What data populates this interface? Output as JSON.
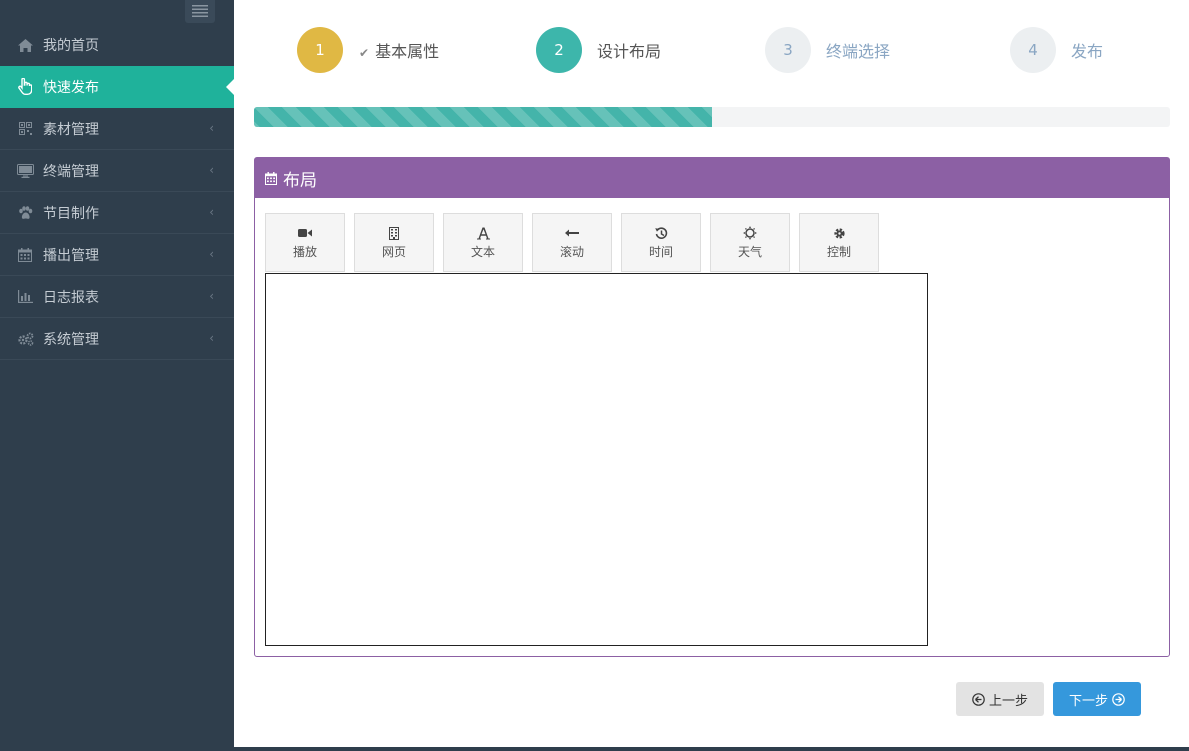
{
  "sidebar": {
    "toggle_icon": "menu-lines-icon",
    "items": [
      {
        "label": "我的首页",
        "icon": "home-icon",
        "active": false
      },
      {
        "label": "快速发布",
        "icon": "hand-pointer-icon",
        "active": true
      },
      {
        "label": "素材管理",
        "icon": "qrcode-icon",
        "active": false
      },
      {
        "label": "终端管理",
        "icon": "monitor-icon",
        "active": false
      },
      {
        "label": "节目制作",
        "icon": "paw-icon",
        "active": false
      },
      {
        "label": "播出管理",
        "icon": "calendar-icon",
        "active": false
      },
      {
        "label": "日志报表",
        "icon": "bar-chart-icon",
        "active": false
      },
      {
        "label": "系统管理",
        "icon": "gears-icon",
        "active": false
      }
    ],
    "colors": {
      "background": "#2f3e4c",
      "active": "#1fb29b"
    }
  },
  "wizard": {
    "steps": [
      {
        "number": "1",
        "label": "基本属性",
        "state": "done",
        "color": "#e0b844"
      },
      {
        "number": "2",
        "label": "设计布局",
        "state": "current",
        "color": "#3db6ab"
      },
      {
        "number": "3",
        "label": "终端选择",
        "state": "pending",
        "color": "#eceff1"
      },
      {
        "number": "4",
        "label": "发布",
        "state": "pending",
        "color": "#eceff1"
      }
    ],
    "progress_fraction": 0.5
  },
  "panel": {
    "title": "布局",
    "title_icon": "calendar-icon",
    "header_color": "#8c60a4",
    "tools": [
      {
        "label": "播放",
        "icon": "video-camera-icon"
      },
      {
        "label": "网页",
        "icon": "building-icon"
      },
      {
        "label": "文本",
        "icon": "font-icon"
      },
      {
        "label": "滚动",
        "icon": "arrow-left-icon"
      },
      {
        "label": "时间",
        "icon": "history-icon"
      },
      {
        "label": "天气",
        "icon": "sun-icon"
      },
      {
        "label": "控制",
        "icon": "cog-icon"
      }
    ]
  },
  "footer": {
    "prev_label": "上一步",
    "next_label": "下一步",
    "next_color": "#3598dc"
  }
}
